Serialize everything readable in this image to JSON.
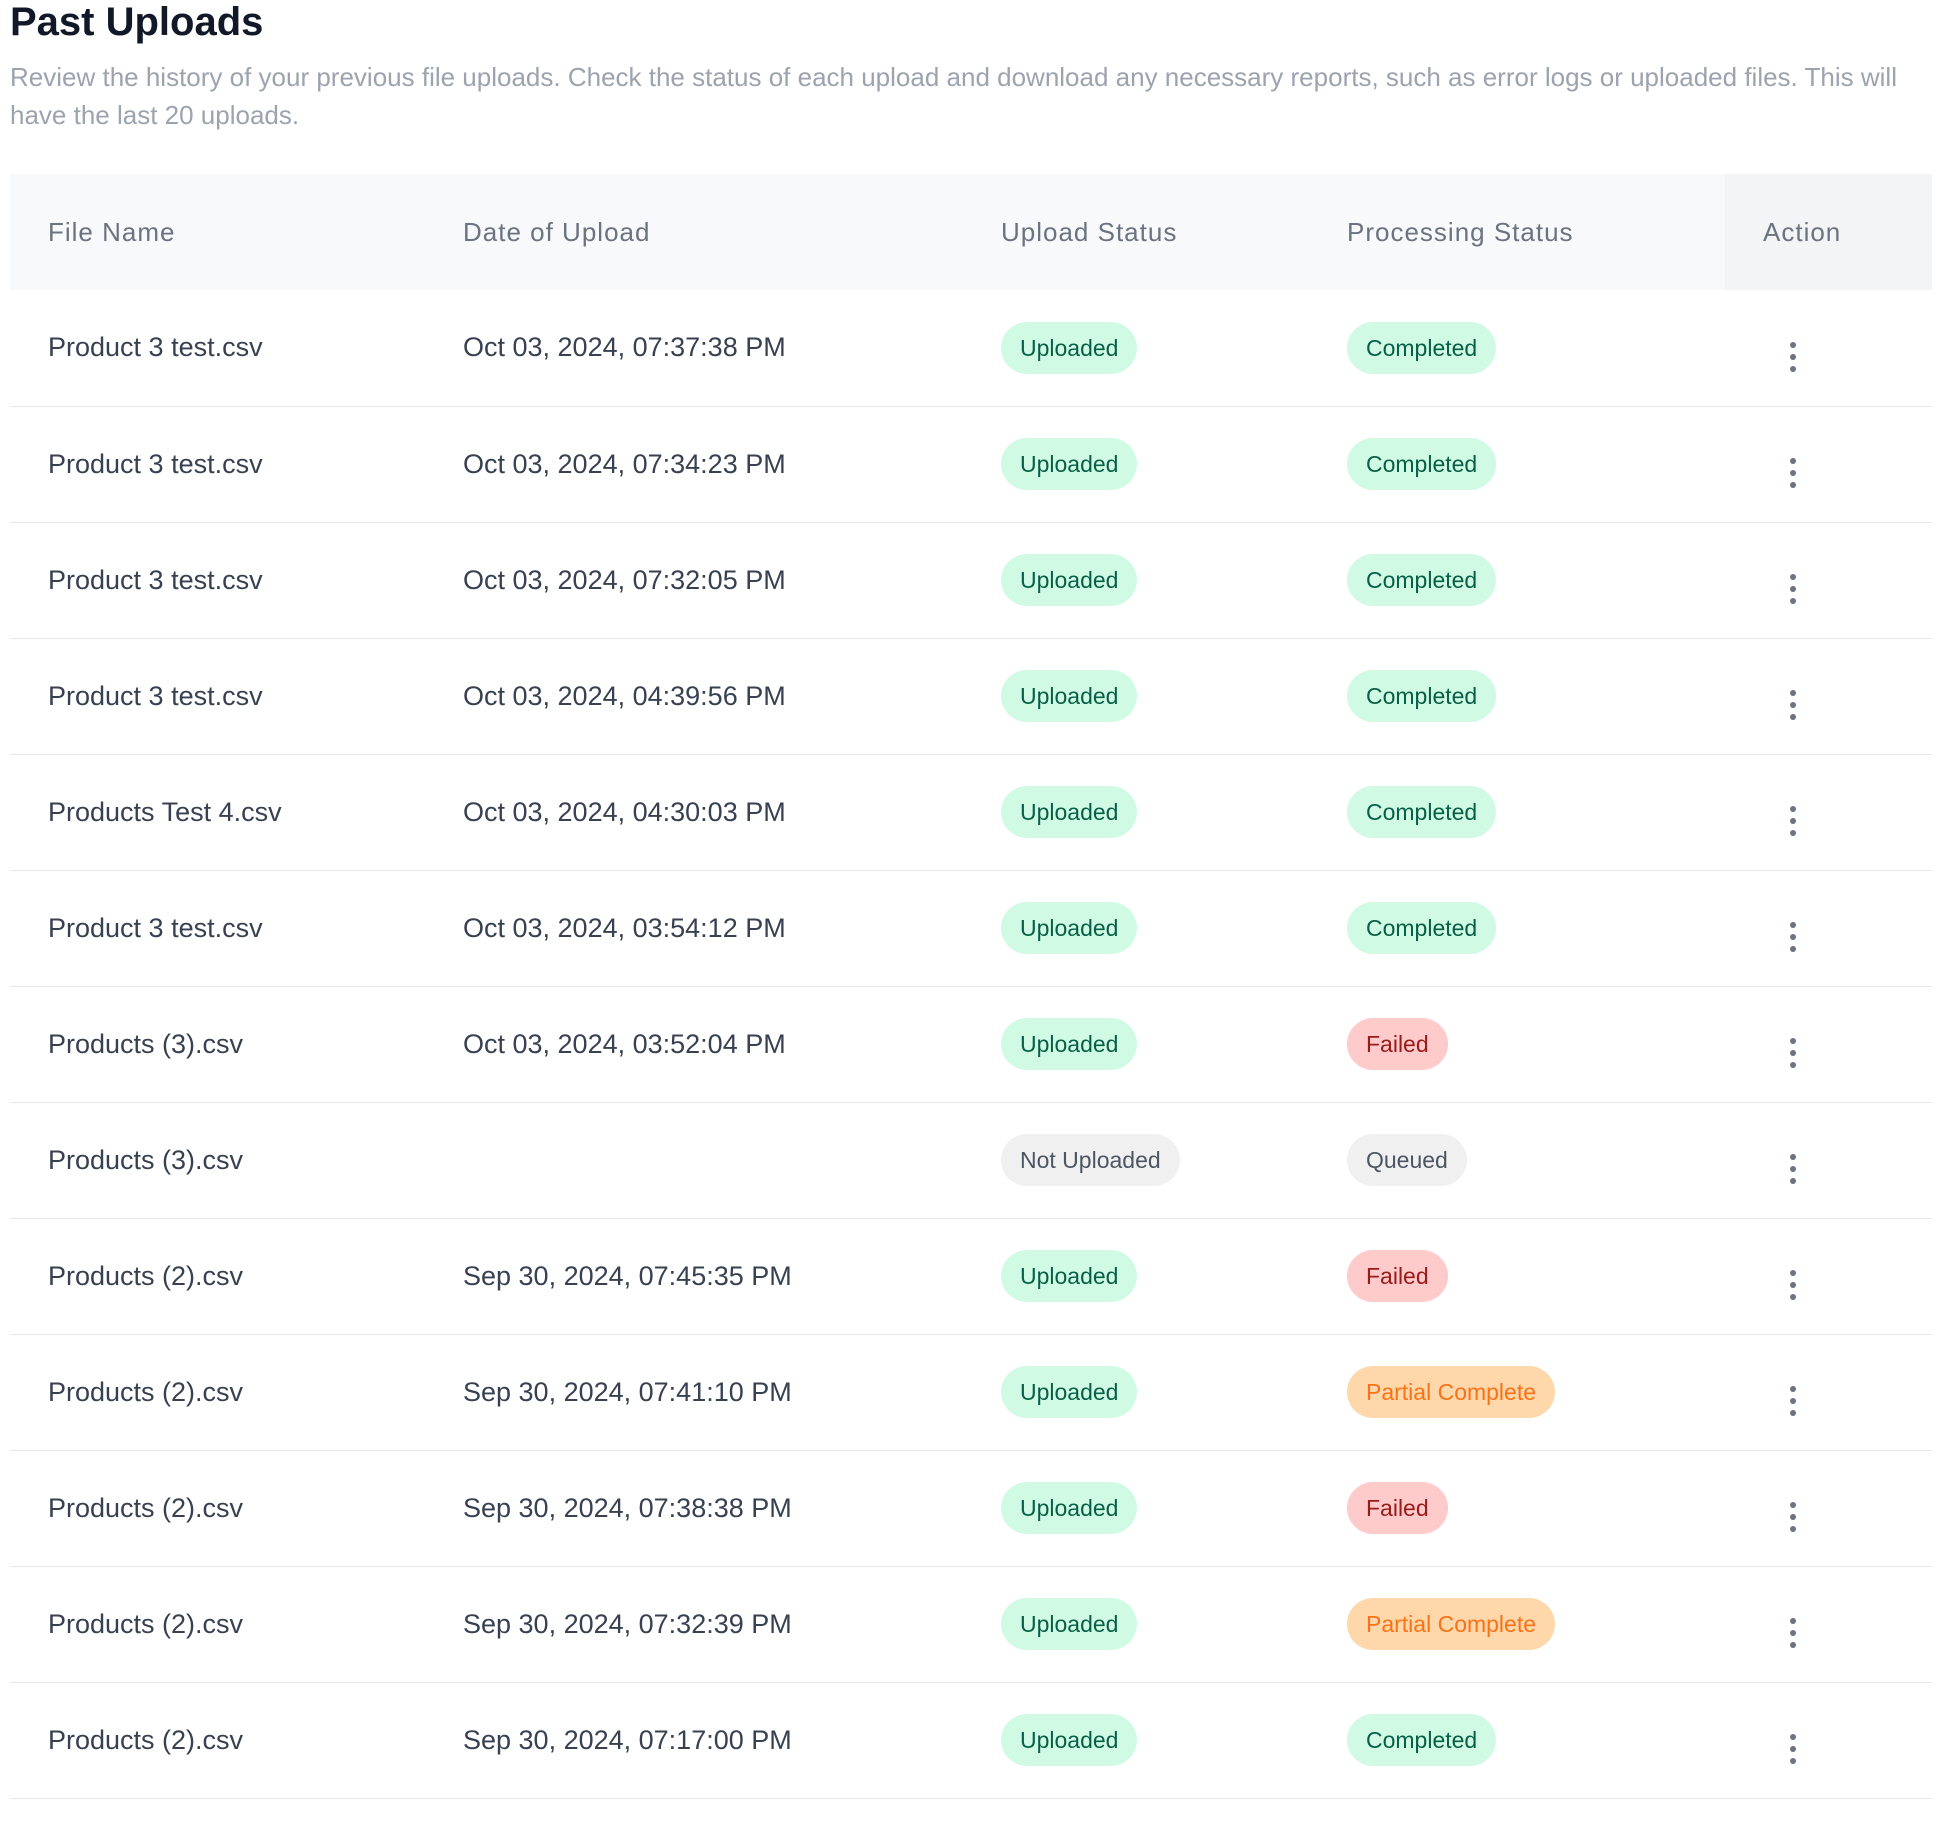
{
  "page": {
    "title": "Past Uploads",
    "subtitle": "Review the history of your previous file uploads. Check the status of each upload and download any necessary reports, such as error logs or uploaded files. This will have the last 20 uploads."
  },
  "table": {
    "headers": {
      "file_name": "File Name",
      "date": "Date of Upload",
      "upload_status": "Upload Status",
      "processing_status": "Processing Status",
      "action": "Action"
    },
    "rows": [
      {
        "file": "Product 3 test.csv",
        "date": "Oct 03, 2024, 07:37:38 PM",
        "upload": "Uploaded",
        "processing": "Completed"
      },
      {
        "file": "Product 3 test.csv",
        "date": "Oct 03, 2024, 07:34:23 PM",
        "upload": "Uploaded",
        "processing": "Completed"
      },
      {
        "file": "Product 3 test.csv",
        "date": "Oct 03, 2024, 07:32:05 PM",
        "upload": "Uploaded",
        "processing": "Completed"
      },
      {
        "file": "Product 3 test.csv",
        "date": "Oct 03, 2024, 04:39:56 PM",
        "upload": "Uploaded",
        "processing": "Completed"
      },
      {
        "file": "Products Test 4.csv",
        "date": "Oct 03, 2024, 04:30:03 PM",
        "upload": "Uploaded",
        "processing": "Completed"
      },
      {
        "file": "Product 3 test.csv",
        "date": "Oct 03, 2024, 03:54:12 PM",
        "upload": "Uploaded",
        "processing": "Completed"
      },
      {
        "file": "Products (3).csv",
        "date": "Oct 03, 2024, 03:52:04 PM",
        "upload": "Uploaded",
        "processing": "Failed"
      },
      {
        "file": "Products (3).csv",
        "date": "",
        "upload": "Not Uploaded",
        "processing": "Queued"
      },
      {
        "file": "Products (2).csv",
        "date": "Sep 30, 2024, 07:45:35 PM",
        "upload": "Uploaded",
        "processing": "Failed"
      },
      {
        "file": "Products (2).csv",
        "date": "Sep 30, 2024, 07:41:10 PM",
        "upload": "Uploaded",
        "processing": "Partial Complete"
      },
      {
        "file": "Products (2).csv",
        "date": "Sep 30, 2024, 07:38:38 PM",
        "upload": "Uploaded",
        "processing": "Failed"
      },
      {
        "file": "Products (2).csv",
        "date": "Sep 30, 2024, 07:32:39 PM",
        "upload": "Uploaded",
        "processing": "Partial Complete"
      },
      {
        "file": "Products (2).csv",
        "date": "Sep 30, 2024, 07:17:00 PM",
        "upload": "Uploaded",
        "processing": "Completed"
      }
    ]
  },
  "icons": {
    "action": "kebab-menu-icon"
  },
  "colors": {
    "success_bg": "#d1fae5",
    "success_text": "#065f46",
    "failed_bg": "#fecaca",
    "failed_text": "#991b1b",
    "partial_bg": "#fed7aa",
    "partial_text": "#f97316",
    "neutral_bg": "#f0f0f0",
    "neutral_text": "#4b5563"
  }
}
